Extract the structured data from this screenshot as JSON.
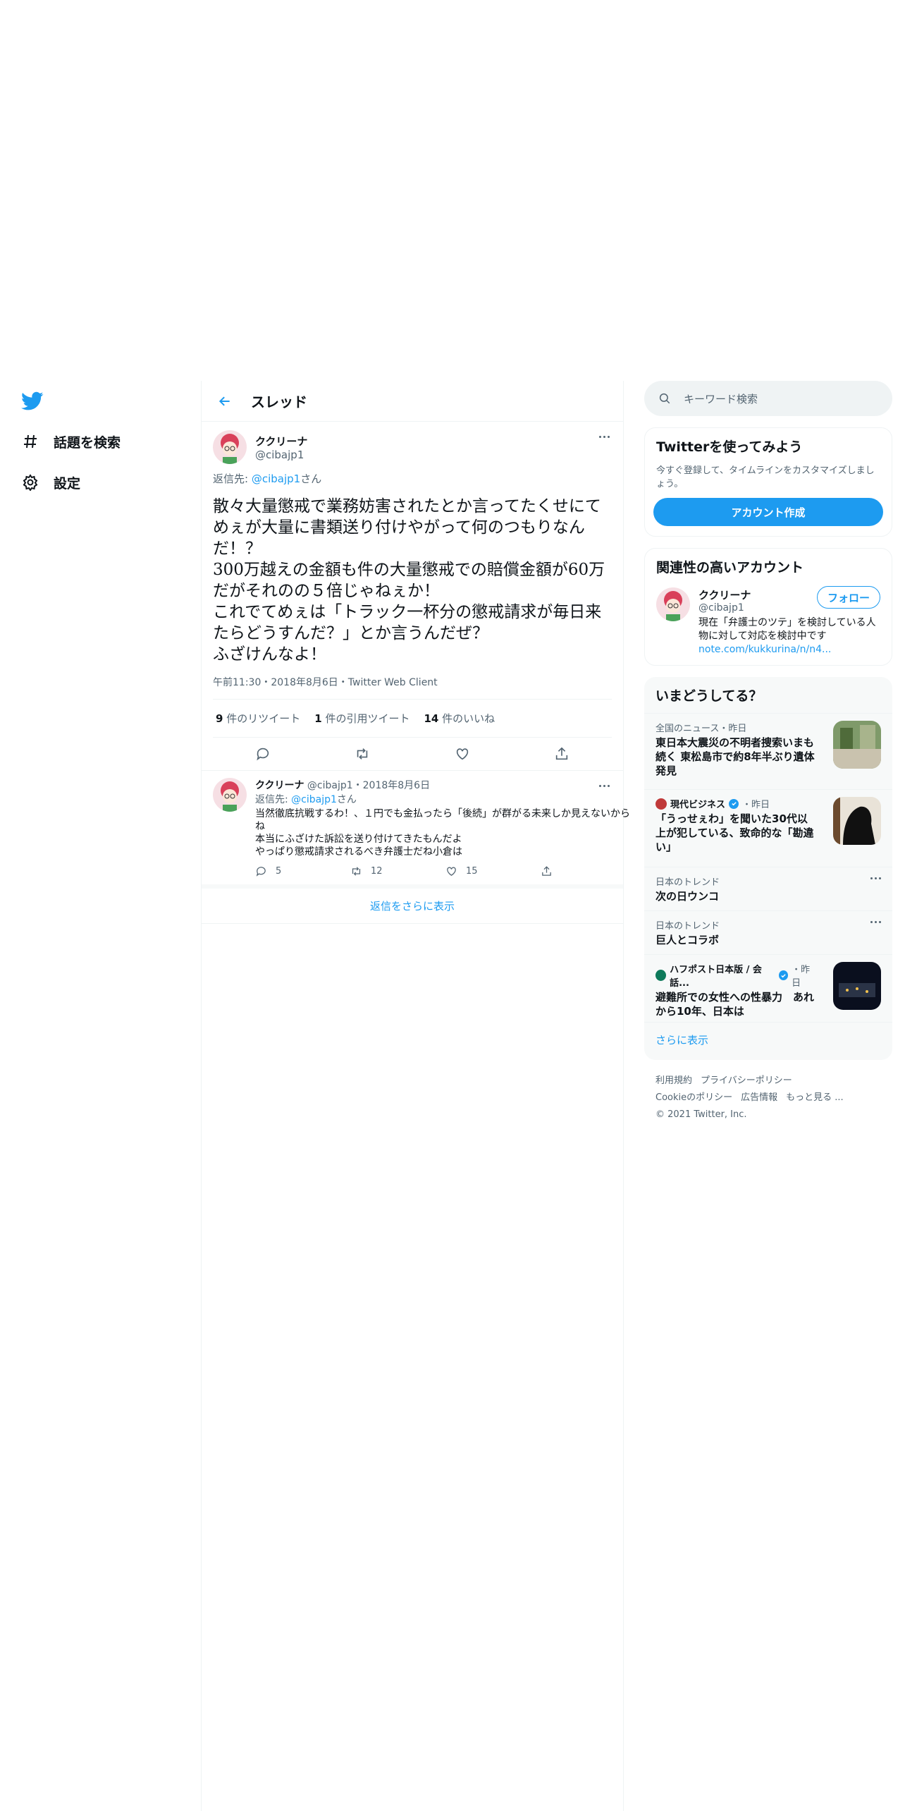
{
  "nav": {
    "items": [
      {
        "label": "話題を検索",
        "icon": "hashtag-icon"
      },
      {
        "label": "設定",
        "icon": "gear-icon"
      }
    ]
  },
  "header": {
    "title": "スレッド"
  },
  "tweet": {
    "name": "ククリーナ",
    "handle": "@cibajp1",
    "reply_prefix": "返信先: ",
    "reply_handle": "@cibajp1",
    "reply_suffix": "さん",
    "body": "散々大量懲戒で業務妨害されたとか言ってたくせにてめぇが大量に書類送り付けやがって何のつもりなんだ！？\n300万越えの金額も件の大量懲戒での賠償金額が60万だがそれのの５倍じゃねぇか！\nこれでてめぇは「トラック一杯分の懲戒請求が毎日来たらどうすんだ？」とか言うんだぜ？\nふざけんなよ！",
    "meta": "午前11:30・2018年8月6日・Twitter Web Client",
    "retweets": "9",
    "retweets_label": "件のリツイート",
    "quotes": "1",
    "quotes_label": "件の引用ツイート",
    "likes": "14",
    "likes_label": "件のいいね"
  },
  "reply": {
    "name": "ククリーナ",
    "handle_date": "@cibajp1・2018年8月6日",
    "reply_prefix": "返信先: ",
    "reply_handle": "@cibajp1",
    "reply_suffix": "さん",
    "body": "当然徹底抗戦するわ！、１円でも金払ったら「後続」が群がる未来しか見えないからね\n本当にふざけた訴訟を送り付けてきたもんだよ\nやっぱり懲戒請求されるべき弁護士だね小倉は",
    "replies": "5",
    "retweets": "12",
    "likes": "15"
  },
  "show_more_replies": "返信をさらに表示",
  "sidebar": {
    "search_placeholder": "キーワード検索",
    "join": {
      "title": "Twitterを使ってみよう",
      "text": "今すぐ登録して、タイムラインをカスタマイズしましょう。",
      "button": "アカウント作成"
    },
    "related": {
      "title": "関連性の高いアカウント",
      "name": "ククリーナ",
      "handle": "@cibajp1",
      "bio": "現在「弁護士のツテ」を検討している人物に対して対応を検討中です",
      "link": "note.com/kukkurina/n/n4...",
      "follow": "フォロー"
    },
    "trends": {
      "title": "いまどうしてる？",
      "items": [
        {
          "context": "全国のニュース・昨日",
          "title": "東日本大震災の不明者捜索いまも続く 東松島市で約8年半ぶり遺体発見"
        },
        {
          "source": "現代ビジネス",
          "time": "・昨日",
          "title": "「うっせぇわ」を聞いた30代以上が犯している、致命的な「勘違い」"
        },
        {
          "context": "日本のトレンド",
          "title": "次の日ウンコ"
        },
        {
          "context": "日本のトレンド",
          "title": "巨人とコラボ"
        },
        {
          "source": "ハフポスト日本版 / 会話...",
          "time": "・昨日",
          "title": "避難所での女性への性暴力　あれから10年、日本は"
        }
      ],
      "see_more": "さらに表示"
    },
    "footer": {
      "links1": [
        "利用規約",
        "プライバシーポリシー"
      ],
      "links2": [
        "Cookieのポリシー",
        "広告情報",
        "もっと見る ..."
      ],
      "copyright": "© 2021 Twitter, Inc."
    }
  },
  "colors": {
    "accent": "#1d9bf0",
    "text": "#0f1419",
    "secondary": "#536471"
  }
}
